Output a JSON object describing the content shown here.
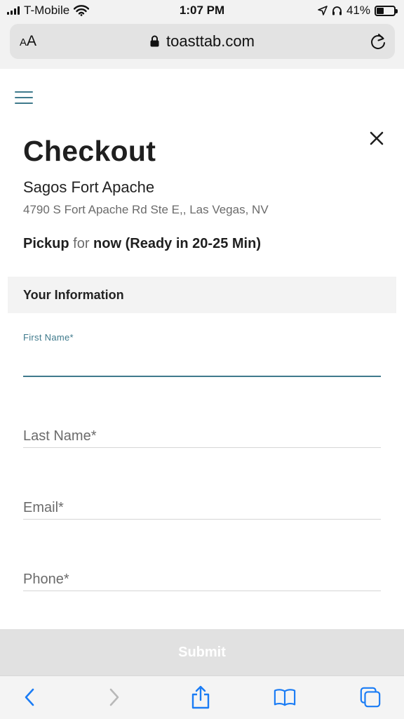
{
  "status_bar": {
    "carrier": "T-Mobile",
    "time": "1:07 PM",
    "battery": "41%",
    "battery_level": 0.41
  },
  "browser": {
    "aa_small": "A",
    "aa_large": "A",
    "url": "toasttab.com"
  },
  "page": {
    "title": "Checkout",
    "restaurant_name": "Sagos Fort Apache",
    "address": "4790 S Fort Apache Rd Ste E,, Las Vegas, NV",
    "pickup": {
      "mode": "Pickup",
      "connector": "for",
      "time": "now (Ready in 20-25 Min)"
    },
    "section_header": "Your Information",
    "fields": {
      "first_name_label": "First Name*",
      "first_name_value": "",
      "last_name_placeholder": "Last Name*",
      "email_placeholder": "Email*",
      "phone_placeholder": "Phone*"
    },
    "submit_label": "Submit"
  },
  "colors": {
    "accent": "#3f7a8c",
    "submit_disabled": "#e1e1e1",
    "ios_blue": "#1a7cf5"
  },
  "icons": {
    "menu": "hamburger-menu-icon",
    "close": "close-icon",
    "lock": "lock-icon",
    "reload": "reload-icon",
    "back": "back-chevron-icon",
    "forward": "forward-chevron-icon",
    "share": "share-icon",
    "bookmarks": "bookmarks-icon",
    "tabs": "tabs-icon"
  }
}
